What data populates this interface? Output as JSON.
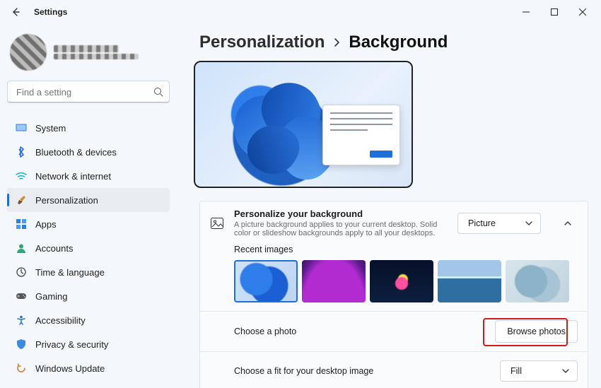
{
  "window": {
    "title": "Settings"
  },
  "search": {
    "placeholder": "Find a setting"
  },
  "nav": {
    "items": [
      {
        "label": "System"
      },
      {
        "label": "Bluetooth & devices"
      },
      {
        "label": "Network & internet"
      },
      {
        "label": "Personalization"
      },
      {
        "label": "Apps"
      },
      {
        "label": "Accounts"
      },
      {
        "label": "Time & language"
      },
      {
        "label": "Gaming"
      },
      {
        "label": "Accessibility"
      },
      {
        "label": "Privacy & security"
      },
      {
        "label": "Windows Update"
      }
    ]
  },
  "breadcrumb": {
    "parent": "Personalization",
    "current": "Background"
  },
  "panel": {
    "title": "Personalize your background",
    "subtitle": "A picture background applies to your current desktop. Solid color or slideshow backgrounds apply to all your desktops.",
    "select_value": "Picture"
  },
  "recent": {
    "title": "Recent images"
  },
  "choose_photo": {
    "label": "Choose a photo",
    "button": "Browse photos"
  },
  "choose_fit": {
    "label": "Choose a fit for your desktop image",
    "value": "Fill"
  }
}
